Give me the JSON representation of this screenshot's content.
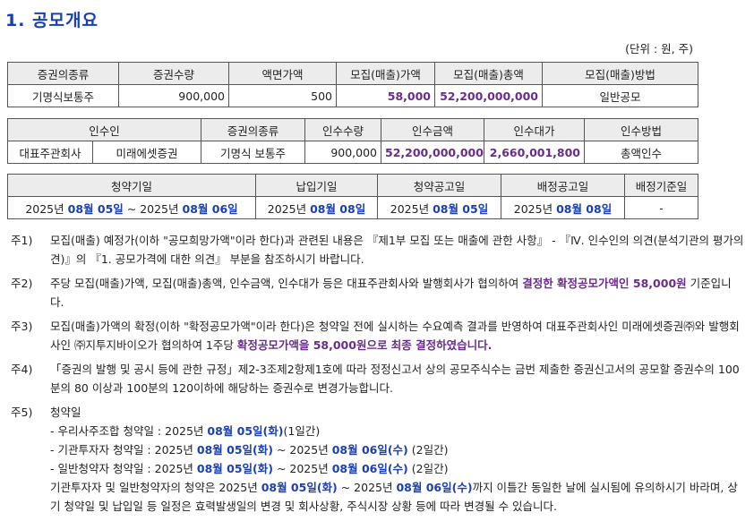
{
  "title": "1. 공모개요",
  "unit": "(단위 : 원, 주)",
  "table1": {
    "headers": [
      "증권의종류",
      "증권수량",
      "액면가액",
      "모집(매출)가액",
      "모집(매출)총액",
      "모집(매출)방법"
    ],
    "row": [
      "기명식보통주",
      "900,000",
      "500",
      "58,000",
      "52,200,000,000",
      "일반공모"
    ]
  },
  "table2": {
    "headers": [
      "인수인",
      "증권의종류",
      "인수수량",
      "인수금액",
      "인수대가",
      "인수방법"
    ],
    "row": [
      "대표주관회사",
      "미래에셋증권",
      "기명식 보통주",
      "900,000",
      "52,200,000,000",
      "2,660,001,800",
      "총액인수"
    ]
  },
  "table3": {
    "headers": [
      "청약기일",
      "납입기일",
      "청약공고일",
      "배정공고일",
      "배정기준일"
    ],
    "subscription": {
      "y1": "2025년",
      "d1": "08월 05일",
      "sep": " ~ ",
      "y2": "2025년",
      "d2": "08월 06일"
    },
    "payment": {
      "y": "2025년",
      "d": "08월 08일"
    },
    "sub_notice": {
      "y": "2025년",
      "d": "08월 05일"
    },
    "alloc_notice": {
      "y": "2025년",
      "d": "08월 08일"
    },
    "alloc_base": "-"
  },
  "notes": {
    "n1": {
      "label": "주1)",
      "text": "모집(매출) 예정가(이하 \"공모희망가액\"이라 한다)과 관련된 내용은 『제1부  모집 또는 매출에 관한 사항』 - 『Ⅳ. 인수인의 의견(분석기관의 평가의견)』의 『1. 공모가격에 대한 의견』 부분을  참조하시기 바랍니다."
    },
    "n2": {
      "label": "주2)",
      "pre": "주당 모집(매출)가액, 모집(매출)총액, 인수금액, 인수대가 등은 대표주관회사와 발행회사가 협의하여 ",
      "em": "결정한 확정공모가액인 58,000원",
      "post": " 기준입니다."
    },
    "n3": {
      "label": "주3)",
      "pre": "모집(매출)가액의 확정(이하 \"확정공모가액\"이라 한다)은 청약일 전에 실시하는 수요예측 결과를 반영하여 대표주관회사인 미래에셋증권㈜와 발행회사인 ㈜지투지바이오가 협의하여 1주당 ",
      "em": "확정공모가액을 58,000원으로 최종 결정하였습니다."
    },
    "n4": {
      "label": "주4)",
      "text": "「증권의 발행 및 공시 등에 관한 규정」제2-3조제2항제1호에 따라 정정신고서 상의 공모주식수는 금번 제출한 증권신고서의 공모할 증권수의 100분의 80 이상과 100분의 120이하에 해당하는 증권수로 변경가능합니다."
    },
    "n5": {
      "label": "주5)",
      "heading": "청약일",
      "l1": {
        "pre": "- 우리사주조합 청약일 : 2025년 ",
        "d": "08월 05일(화)",
        "post": "(1일간)"
      },
      "l2": {
        "pre": "- 기관투자자 청약일 : 2025년 ",
        "d1": "08월 05일(화)",
        "mid": " ~ 2025년 ",
        "d2": "08월 06일(수)",
        "post": " (2일간)"
      },
      "l3": {
        "pre": "- 일반청약자 청약일 : 2025년 ",
        "d1": "08월 05일(화)",
        "mid": " ~ 2025년 ",
        "d2": "08월 06일(수)",
        "post": " (2일간)"
      },
      "l4": {
        "pre": "기관투자자 및 일반청약자의 청약은 2025년 ",
        "d1": "08월 05일(화)",
        "mid": " ~ 2025년 ",
        "d2": "08월 06일(수)",
        "post": "까지 이틀간 동일한 날에 실시됨에 유의하시기 바라며, 상기 청약일 및 납입일 등 일정은 효력발생일의 변경 및 회사상황, 주식시장 상황 등에 따라 변경될 수 있습니다."
      }
    }
  }
}
